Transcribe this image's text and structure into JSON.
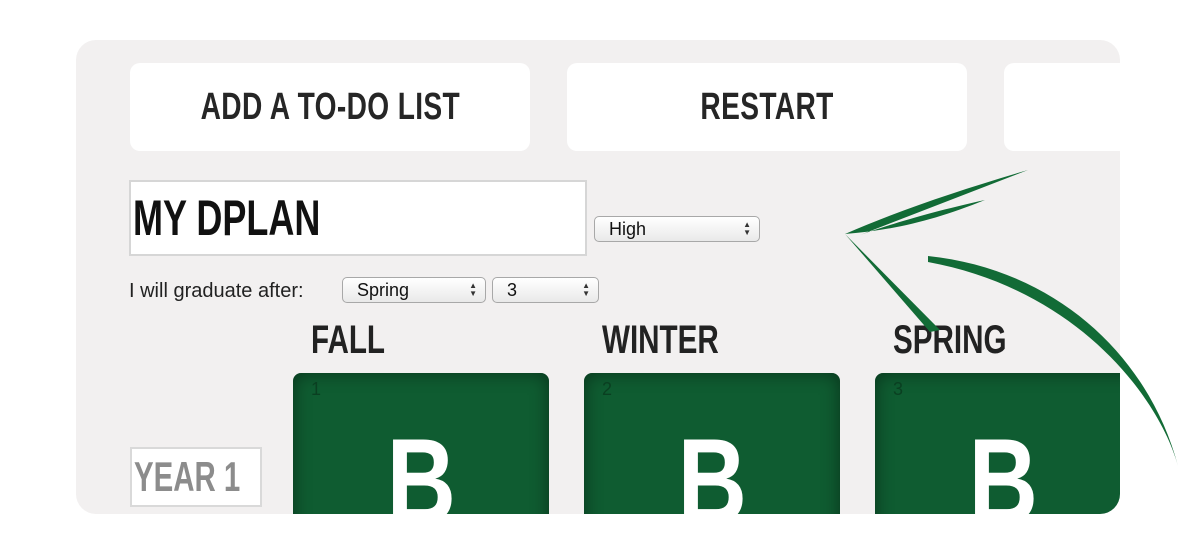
{
  "toolbar": {
    "add_todo_label": "ADD A TO-DO LIST",
    "restart_label": "RESTART",
    "third_label": ""
  },
  "plan": {
    "name": "MY DPLAN",
    "priority": "High"
  },
  "graduation": {
    "label": "I will graduate after:",
    "term": "Spring",
    "year": "3"
  },
  "seasons": [
    "FALL",
    "WINTER",
    "SPRING"
  ],
  "year_row": {
    "label": "YEAR 1",
    "terms": [
      {
        "number": "1",
        "letter": "B"
      },
      {
        "number": "2",
        "letter": "B"
      },
      {
        "number": "3",
        "letter": "B"
      }
    ]
  },
  "colors": {
    "frame_bg": "#f2f0f0",
    "card_green": "#0f5c31",
    "arrow_green": "#126b36"
  },
  "icons": {
    "select_arrows": "updown-chevron-icon",
    "annotation": "curved-arrow-icon"
  }
}
